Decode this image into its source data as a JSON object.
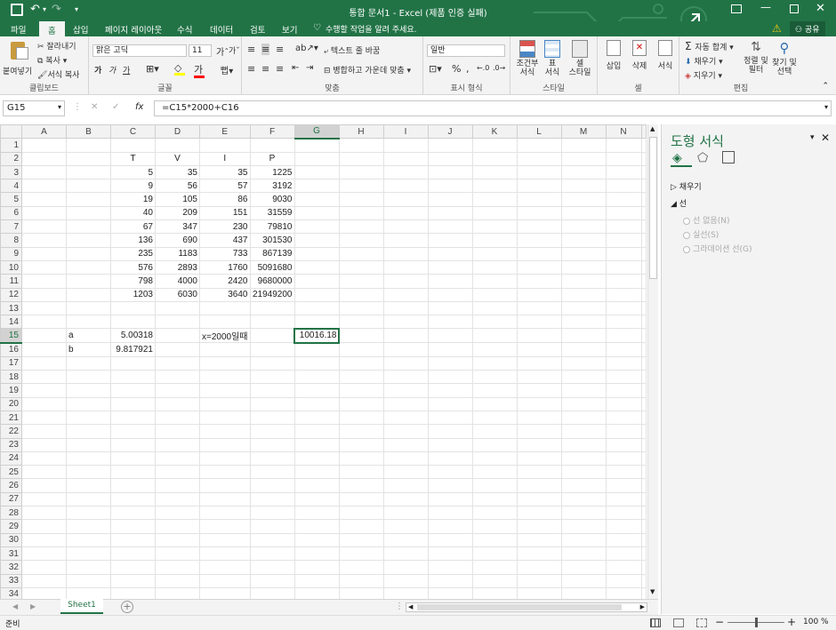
{
  "title_bar": {
    "title": "통합 문서1 - Excel (제품 인증 실패)",
    "icons": [
      "save-icon",
      "undo-icon",
      "redo-icon",
      "customize-qat-icon",
      "ribbon-display-icon",
      "minimize-icon",
      "maximize-icon",
      "close-icon"
    ]
  },
  "ribbon_tabs": {
    "items": [
      "파일",
      "홈",
      "삽입",
      "페이지 레이아웃",
      "수식",
      "데이터",
      "검토",
      "보기"
    ],
    "active": "홈",
    "tell_me": "수행할 작업을 알려 주세요.",
    "warning_icon": "warning-icon",
    "share": "공유"
  },
  "clipboard": {
    "paste": "붙여넣기",
    "cut": "잘라내기",
    "copy": "복사",
    "format_painter": "서식 복사",
    "label": "클립보드"
  },
  "font": {
    "name": "맑은 고딕",
    "size": "11",
    "bold": "가",
    "italic": "가",
    "underline": "가",
    "label": "글꼴",
    "font_color": "#ff0000",
    "fill_color": "#ffff00"
  },
  "alignment": {
    "wrap": "텍스트 줄 바꿈",
    "merge": "병합하고 가운데 맞춤",
    "label": "맞춤"
  },
  "number": {
    "format": "일반",
    "percent": "%",
    "comma": ",",
    "label": "표시 형식"
  },
  "styles": {
    "conditional": "조건부\n서식",
    "table": "표\n서식",
    "cell_styles": "셀\n스타일",
    "label": "스타일"
  },
  "cells": {
    "insert": "삽입",
    "delete": "삭제",
    "format": "서식",
    "label": "셀"
  },
  "editing": {
    "autosum": "자동 합계",
    "fill": "채우기",
    "clear": "지우기",
    "sort": "정렬 및\n필터",
    "find": "찾기 및\n선택",
    "label": "편집"
  },
  "formula_bar": {
    "name_box": "G15",
    "formula": "=C15*2000+C16",
    "fx": "fx"
  },
  "grid": {
    "columns": [
      "A",
      "B",
      "C",
      "D",
      "E",
      "F",
      "G",
      "H",
      "I",
      "J",
      "K",
      "L",
      "M",
      "N"
    ],
    "selected_cell": "G15",
    "rows": [
      {
        "r": "1",
        "cells": [
          "",
          "",
          "",
          "",
          "",
          "",
          "",
          "",
          "",
          "",
          "",
          "",
          "",
          ""
        ]
      },
      {
        "r": "2",
        "cells": [
          "",
          "",
          "T",
          "V",
          "I",
          "P",
          "",
          "",
          "",
          "",
          "",
          "",
          "",
          ""
        ]
      },
      {
        "r": "3",
        "cells": [
          "",
          "",
          "5",
          "35",
          "35",
          "1225",
          "",
          "",
          "",
          "",
          "",
          "",
          "",
          ""
        ]
      },
      {
        "r": "4",
        "cells": [
          "",
          "",
          "9",
          "56",
          "57",
          "3192",
          "",
          "",
          "",
          "",
          "",
          "",
          "",
          ""
        ]
      },
      {
        "r": "5",
        "cells": [
          "",
          "",
          "19",
          "105",
          "86",
          "9030",
          "",
          "",
          "",
          "",
          "",
          "",
          "",
          ""
        ]
      },
      {
        "r": "6",
        "cells": [
          "",
          "",
          "40",
          "209",
          "151",
          "31559",
          "",
          "",
          "",
          "",
          "",
          "",
          "",
          ""
        ]
      },
      {
        "r": "7",
        "cells": [
          "",
          "",
          "67",
          "347",
          "230",
          "79810",
          "",
          "",
          "",
          "",
          "",
          "",
          "",
          ""
        ]
      },
      {
        "r": "8",
        "cells": [
          "",
          "",
          "136",
          "690",
          "437",
          "301530",
          "",
          "",
          "",
          "",
          "",
          "",
          "",
          ""
        ]
      },
      {
        "r": "9",
        "cells": [
          "",
          "",
          "235",
          "1183",
          "733",
          "867139",
          "",
          "",
          "",
          "",
          "",
          "",
          "",
          ""
        ]
      },
      {
        "r": "10",
        "cells": [
          "",
          "",
          "576",
          "2893",
          "1760",
          "5091680",
          "",
          "",
          "",
          "",
          "",
          "",
          "",
          ""
        ]
      },
      {
        "r": "11",
        "cells": [
          "",
          "",
          "798",
          "4000",
          "2420",
          "9680000",
          "",
          "",
          "",
          "",
          "",
          "",
          "",
          ""
        ]
      },
      {
        "r": "12",
        "cells": [
          "",
          "",
          "1203",
          "6030",
          "3640",
          "21949200",
          "",
          "",
          "",
          "",
          "",
          "",
          "",
          ""
        ]
      },
      {
        "r": "13",
        "cells": [
          "",
          "",
          "",
          "",
          "",
          "",
          "",
          "",
          "",
          "",
          "",
          "",
          "",
          ""
        ]
      },
      {
        "r": "14",
        "cells": [
          "",
          "",
          "",
          "",
          "",
          "",
          "",
          "",
          "",
          "",
          "",
          "",
          "",
          ""
        ]
      },
      {
        "r": "15",
        "cells": [
          "",
          "a",
          "5.00318",
          "",
          "x=2000일때",
          "",
          "10016.18",
          "",
          "",
          "",
          "",
          "",
          "",
          ""
        ]
      },
      {
        "r": "16",
        "cells": [
          "",
          "b",
          "9.817921",
          "",
          "",
          "",
          "",
          "",
          "",
          "",
          "",
          "",
          "",
          ""
        ]
      },
      {
        "r": "17",
        "cells": [
          "",
          "",
          "",
          "",
          "",
          "",
          "",
          "",
          "",
          "",
          "",
          "",
          "",
          ""
        ]
      },
      {
        "r": "18",
        "cells": [
          "",
          "",
          "",
          "",
          "",
          "",
          "",
          "",
          "",
          "",
          "",
          "",
          "",
          ""
        ]
      },
      {
        "r": "19",
        "cells": [
          "",
          "",
          "",
          "",
          "",
          "",
          "",
          "",
          "",
          "",
          "",
          "",
          "",
          ""
        ]
      },
      {
        "r": "20",
        "cells": [
          "",
          "",
          "",
          "",
          "",
          "",
          "",
          "",
          "",
          "",
          "",
          "",
          "",
          ""
        ]
      },
      {
        "r": "21",
        "cells": [
          "",
          "",
          "",
          "",
          "",
          "",
          "",
          "",
          "",
          "",
          "",
          "",
          "",
          ""
        ]
      },
      {
        "r": "22",
        "cells": [
          "",
          "",
          "",
          "",
          "",
          "",
          "",
          "",
          "",
          "",
          "",
          "",
          "",
          ""
        ]
      },
      {
        "r": "23",
        "cells": [
          "",
          "",
          "",
          "",
          "",
          "",
          "",
          "",
          "",
          "",
          "",
          "",
          "",
          ""
        ]
      },
      {
        "r": "24",
        "cells": [
          "",
          "",
          "",
          "",
          "",
          "",
          "",
          "",
          "",
          "",
          "",
          "",
          "",
          ""
        ]
      },
      {
        "r": "25",
        "cells": [
          "",
          "",
          "",
          "",
          "",
          "",
          "",
          "",
          "",
          "",
          "",
          "",
          "",
          ""
        ]
      },
      {
        "r": "26",
        "cells": [
          "",
          "",
          "",
          "",
          "",
          "",
          "",
          "",
          "",
          "",
          "",
          "",
          "",
          ""
        ]
      },
      {
        "r": "27",
        "cells": [
          "",
          "",
          "",
          "",
          "",
          "",
          "",
          "",
          "",
          "",
          "",
          "",
          "",
          ""
        ]
      },
      {
        "r": "28",
        "cells": [
          "",
          "",
          "",
          "",
          "",
          "",
          "",
          "",
          "",
          "",
          "",
          "",
          "",
          ""
        ]
      },
      {
        "r": "29",
        "cells": [
          "",
          "",
          "",
          "",
          "",
          "",
          "",
          "",
          "",
          "",
          "",
          "",
          "",
          ""
        ]
      },
      {
        "r": "30",
        "cells": [
          "",
          "",
          "",
          "",
          "",
          "",
          "",
          "",
          "",
          "",
          "",
          "",
          "",
          ""
        ]
      },
      {
        "r": "31",
        "cells": [
          "",
          "",
          "",
          "",
          "",
          "",
          "",
          "",
          "",
          "",
          "",
          "",
          "",
          ""
        ]
      },
      {
        "r": "32",
        "cells": [
          "",
          "",
          "",
          "",
          "",
          "",
          "",
          "",
          "",
          "",
          "",
          "",
          "",
          ""
        ]
      },
      {
        "r": "33",
        "cells": [
          "",
          "",
          "",
          "",
          "",
          "",
          "",
          "",
          "",
          "",
          "",
          "",
          "",
          ""
        ]
      },
      {
        "r": "34",
        "cells": [
          "",
          "",
          "",
          "",
          "",
          "",
          "",
          "",
          "",
          "",
          "",
          "",
          "",
          ""
        ]
      }
    ]
  },
  "format_pane": {
    "title": "도형 서식",
    "fill": "채우기",
    "line": "선",
    "options": [
      "선 없음(N)",
      "실선(S)",
      "그라데이션 선(G)"
    ]
  },
  "sheet_tabs": {
    "active": "Sheet1",
    "add": "+"
  },
  "status_bar": {
    "ready": "준비",
    "zoom": "100 %",
    "zoom_level": 0.5
  },
  "colors": {
    "excel_green": "#217346",
    "selection_outline": "#217346"
  }
}
